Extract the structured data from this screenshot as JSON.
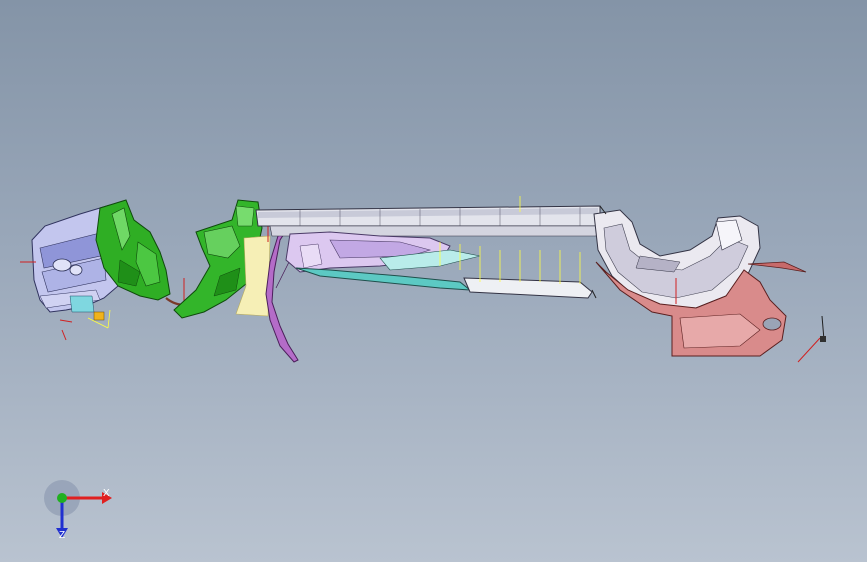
{
  "viewport": {
    "background_top": "#8494a7",
    "background_bottom": "#b9c3d0"
  },
  "triad": {
    "x_label": "X",
    "z_label": "Z",
    "x_color": "#e02020",
    "y_color": "#20b020",
    "z_color": "#2030d0"
  },
  "parts": [
    {
      "name": "front-bumper-grille",
      "color": "#c7c3ef"
    },
    {
      "name": "front-fender-liner",
      "color": "#2fae24"
    },
    {
      "name": "wheel-arch-liner-front",
      "color": "#33b52a"
    },
    {
      "name": "side-sill-rail",
      "color": "#d9dbe6"
    },
    {
      "name": "interior-panel",
      "color": "#d8c4ee"
    },
    {
      "name": "lower-trim-strip",
      "color": "#5cc9c3"
    },
    {
      "name": "rear-wheel-house",
      "color": "#e9e7ef"
    },
    {
      "name": "rear-bracket",
      "color": "#d98b8b"
    }
  ]
}
